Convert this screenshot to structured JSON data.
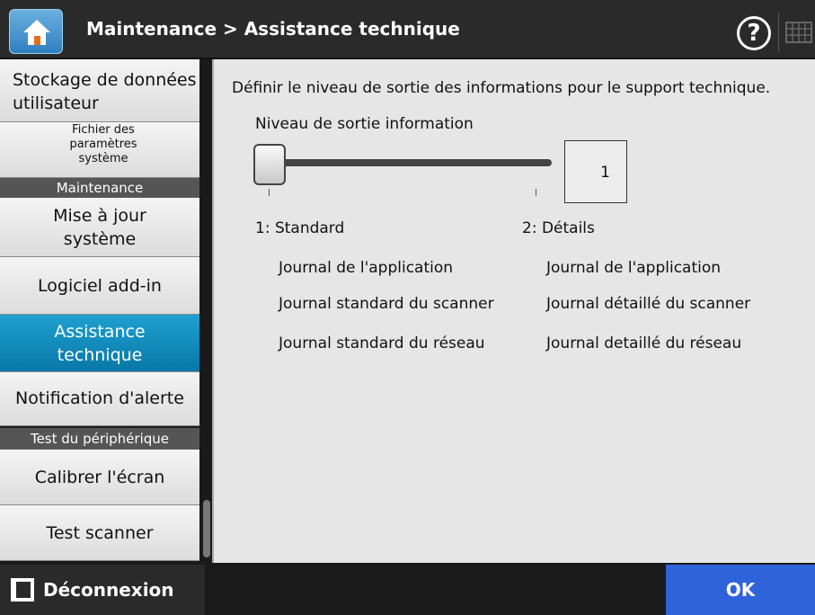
{
  "header": {
    "title": "Maintenance > Assistance technique",
    "help_label": "?"
  },
  "sidebar": {
    "items": [
      {
        "label": "Stockage de données utilisateur"
      },
      {
        "label": "Fichier des paramètres système"
      },
      {
        "category": "Maintenance"
      },
      {
        "label": "Mise à jour système"
      },
      {
        "label": "Logiciel add-in"
      },
      {
        "label": "Assistance technique",
        "active": true
      },
      {
        "label": "Notification d'alerte"
      },
      {
        "category": "Test du périphérique"
      },
      {
        "label": "Calibrer l'écran"
      },
      {
        "label": "Test scanner"
      }
    ]
  },
  "main": {
    "description": "Définir le niveau de sortie des informations pour le support technique.",
    "level_label": "Niveau de sortie information",
    "level_value": "1",
    "slider_min": 1,
    "slider_max": 2,
    "slider_value": 1,
    "columns": [
      {
        "heading": "1: Standard",
        "items": [
          "Journal de l'application",
          "Journal standard du scanner",
          "Journal standard du réseau"
        ]
      },
      {
        "heading": "2: Détails",
        "items": [
          "Journal de l'application",
          "Journal détaillé du scanner",
          "Journal detaillé du réseau"
        ]
      }
    ]
  },
  "footer": {
    "logout_label": "Déconnexion",
    "ok_label": "OK"
  },
  "colors": {
    "active_item": "#0878a8",
    "ok_button": "#2f63d9",
    "header_bg": "#2a2a2a"
  }
}
